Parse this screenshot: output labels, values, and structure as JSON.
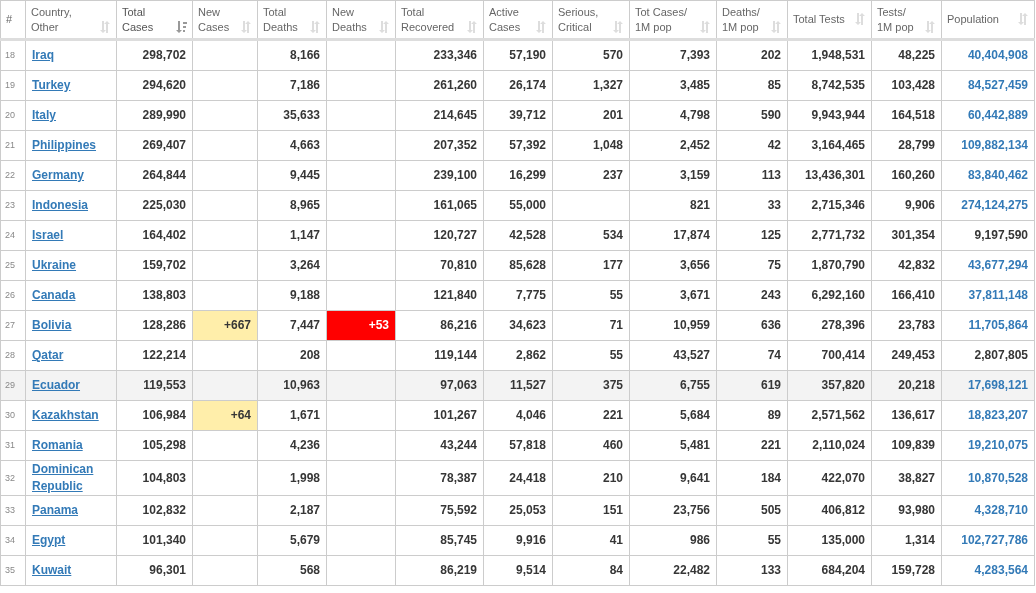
{
  "table": {
    "columns": [
      {
        "label": "#",
        "sortable": false
      },
      {
        "label": "Country, Other",
        "sortable": true,
        "sorted": false
      },
      {
        "label": "Total Cases",
        "sortable": true,
        "sorted": true
      },
      {
        "label": "New Cases",
        "sortable": true,
        "sorted": false
      },
      {
        "label": "Total Deaths",
        "sortable": true,
        "sorted": false
      },
      {
        "label": "New Deaths",
        "sortable": true,
        "sorted": false
      },
      {
        "label": "Total Recovered",
        "sortable": true,
        "sorted": false
      },
      {
        "label": "Active Cases",
        "sortable": true,
        "sorted": false
      },
      {
        "label": "Serious, Critical",
        "sortable": true,
        "sorted": false
      },
      {
        "label": "Tot Cases/ 1M pop",
        "sortable": true,
        "sorted": false
      },
      {
        "label": "Deaths/ 1M pop",
        "sortable": true,
        "sorted": false
      },
      {
        "label": "Total Tests",
        "sortable": true,
        "sorted": false
      },
      {
        "label": "Tests/ 1M pop",
        "sortable": true,
        "sorted": false
      },
      {
        "label": "Population",
        "sortable": true,
        "sorted": false
      }
    ],
    "rows": [
      {
        "rank": "18",
        "country": "Iraq",
        "total_cases": "298,702",
        "total_deaths": "8,166",
        "total_recovered": "233,346",
        "active_cases": "57,190",
        "serious": "570",
        "cases_per_1m": "7,393",
        "deaths_per_1m": "202",
        "total_tests": "1,948,531",
        "tests_per_1m": "48,225",
        "population": "40,404,908",
        "population_linked": true,
        "highlighted": false
      },
      {
        "rank": "19",
        "country": "Turkey",
        "total_cases": "294,620",
        "total_deaths": "7,186",
        "total_recovered": "261,260",
        "active_cases": "26,174",
        "serious": "1,327",
        "cases_per_1m": "3,485",
        "deaths_per_1m": "85",
        "total_tests": "8,742,535",
        "tests_per_1m": "103,428",
        "population": "84,527,459",
        "population_linked": true,
        "highlighted": false
      },
      {
        "rank": "20",
        "country": "Italy",
        "total_cases": "289,990",
        "total_deaths": "35,633",
        "total_recovered": "214,645",
        "active_cases": "39,712",
        "serious": "201",
        "cases_per_1m": "4,798",
        "deaths_per_1m": "590",
        "total_tests": "9,943,944",
        "tests_per_1m": "164,518",
        "population": "60,442,889",
        "population_linked": true,
        "highlighted": false
      },
      {
        "rank": "21",
        "country": "Philippines",
        "total_cases": "269,407",
        "total_deaths": "4,663",
        "total_recovered": "207,352",
        "active_cases": "57,392",
        "serious": "1,048",
        "cases_per_1m": "2,452",
        "deaths_per_1m": "42",
        "total_tests": "3,164,465",
        "tests_per_1m": "28,799",
        "population": "109,882,134",
        "population_linked": true,
        "highlighted": false
      },
      {
        "rank": "22",
        "country": "Germany",
        "total_cases": "264,844",
        "total_deaths": "9,445",
        "total_recovered": "239,100",
        "active_cases": "16,299",
        "serious": "237",
        "cases_per_1m": "3,159",
        "deaths_per_1m": "113",
        "total_tests": "13,436,301",
        "tests_per_1m": "160,260",
        "population": "83,840,462",
        "population_linked": true,
        "highlighted": false
      },
      {
        "rank": "23",
        "country": "Indonesia",
        "total_cases": "225,030",
        "total_deaths": "8,965",
        "total_recovered": "161,065",
        "active_cases": "55,000",
        "cases_per_1m": "821",
        "deaths_per_1m": "33",
        "total_tests": "2,715,346",
        "tests_per_1m": "9,906",
        "population": "274,124,275",
        "population_linked": true,
        "highlighted": false
      },
      {
        "rank": "24",
        "country": "Israel",
        "total_cases": "164,402",
        "total_deaths": "1,147",
        "total_recovered": "120,727",
        "active_cases": "42,528",
        "serious": "534",
        "cases_per_1m": "17,874",
        "deaths_per_1m": "125",
        "total_tests": "2,771,732",
        "tests_per_1m": "301,354",
        "population": "9,197,590",
        "population_linked": false,
        "highlighted": false
      },
      {
        "rank": "25",
        "country": "Ukraine",
        "total_cases": "159,702",
        "total_deaths": "3,264",
        "total_recovered": "70,810",
        "active_cases": "85,628",
        "serious": "177",
        "cases_per_1m": "3,656",
        "deaths_per_1m": "75",
        "total_tests": "1,870,790",
        "tests_per_1m": "42,832",
        "population": "43,677,294",
        "population_linked": true,
        "highlighted": false
      },
      {
        "rank": "26",
        "country": "Canada",
        "total_cases": "138,803",
        "total_deaths": "9,188",
        "total_recovered": "121,840",
        "active_cases": "7,775",
        "serious": "55",
        "cases_per_1m": "3,671",
        "deaths_per_1m": "243",
        "total_tests": "6,292,160",
        "tests_per_1m": "166,410",
        "population": "37,811,148",
        "population_linked": true,
        "highlighted": false
      },
      {
        "rank": "27",
        "country": "Bolivia",
        "total_cases": "128,286",
        "new_cases": "+667",
        "total_deaths": "7,447",
        "new_deaths": "+53",
        "total_recovered": "86,216",
        "active_cases": "34,623",
        "serious": "71",
        "cases_per_1m": "10,959",
        "deaths_per_1m": "636",
        "total_tests": "278,396",
        "tests_per_1m": "23,783",
        "population": "11,705,864",
        "population_linked": true,
        "highlighted": false
      },
      {
        "rank": "28",
        "country": "Qatar",
        "total_cases": "122,214",
        "total_deaths": "208",
        "total_recovered": "119,144",
        "active_cases": "2,862",
        "serious": "55",
        "cases_per_1m": "43,527",
        "deaths_per_1m": "74",
        "total_tests": "700,414",
        "tests_per_1m": "249,453",
        "population": "2,807,805",
        "population_linked": false,
        "highlighted": false
      },
      {
        "rank": "29",
        "country": "Ecuador",
        "total_cases": "119,553",
        "total_deaths": "10,963",
        "total_recovered": "97,063",
        "active_cases": "11,527",
        "serious": "375",
        "cases_per_1m": "6,755",
        "deaths_per_1m": "619",
        "total_tests": "357,820",
        "tests_per_1m": "20,218",
        "population": "17,698,121",
        "population_linked": true,
        "highlighted": true
      },
      {
        "rank": "30",
        "country": "Kazakhstan",
        "total_cases": "106,984",
        "new_cases": "+64",
        "total_deaths": "1,671",
        "total_recovered": "101,267",
        "active_cases": "4,046",
        "serious": "221",
        "cases_per_1m": "5,684",
        "deaths_per_1m": "89",
        "total_tests": "2,571,562",
        "tests_per_1m": "136,617",
        "population": "18,823,207",
        "population_linked": true,
        "highlighted": false
      },
      {
        "rank": "31",
        "country": "Romania",
        "total_cases": "105,298",
        "total_deaths": "4,236",
        "total_recovered": "43,244",
        "active_cases": "57,818",
        "serious": "460",
        "cases_per_1m": "5,481",
        "deaths_per_1m": "221",
        "total_tests": "2,110,024",
        "tests_per_1m": "109,839",
        "population": "19,210,075",
        "population_linked": true,
        "highlighted": false
      },
      {
        "rank": "32",
        "country": "Dominican Republic",
        "total_cases": "104,803",
        "total_deaths": "1,998",
        "total_recovered": "78,387",
        "active_cases": "24,418",
        "serious": "210",
        "cases_per_1m": "9,641",
        "deaths_per_1m": "184",
        "total_tests": "422,070",
        "tests_per_1m": "38,827",
        "population": "10,870,528",
        "population_linked": true,
        "highlighted": false
      },
      {
        "rank": "33",
        "country": "Panama",
        "total_cases": "102,832",
        "total_deaths": "2,187",
        "total_recovered": "75,592",
        "active_cases": "25,053",
        "serious": "151",
        "cases_per_1m": "23,756",
        "deaths_per_1m": "505",
        "total_tests": "406,812",
        "tests_per_1m": "93,980",
        "population": "4,328,710",
        "population_linked": true,
        "highlighted": false
      },
      {
        "rank": "34",
        "country": "Egypt",
        "total_cases": "101,340",
        "total_deaths": "5,679",
        "total_recovered": "85,745",
        "active_cases": "9,916",
        "serious": "41",
        "cases_per_1m": "986",
        "deaths_per_1m": "55",
        "total_tests": "135,000",
        "tests_per_1m": "1,314",
        "population": "102,727,786",
        "population_linked": true,
        "highlighted": false
      },
      {
        "rank": "35",
        "country": "Kuwait",
        "total_cases": "96,301",
        "total_deaths": "568",
        "total_recovered": "86,219",
        "active_cases": "9,514",
        "serious": "84",
        "cases_per_1m": "22,482",
        "deaths_per_1m": "133",
        "total_tests": "684,204",
        "tests_per_1m": "159,728",
        "population": "4,283,564",
        "population_linked": true,
        "highlighted": false
      }
    ]
  }
}
